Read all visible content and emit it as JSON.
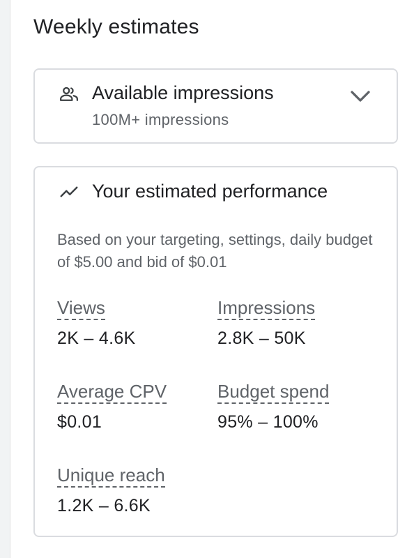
{
  "panel": {
    "title": "Weekly estimates"
  },
  "available_impressions": {
    "icon": "people-icon",
    "title": "Available impressions",
    "subtitle": "100M+ impressions",
    "expand_icon": "chevron-down-icon"
  },
  "performance": {
    "icon": "trending-line-icon",
    "title": "Your estimated performance",
    "description": "Based on your targeting, settings, daily budget of $5.00 and bid of $0.01",
    "metrics": [
      {
        "label": "Views",
        "value": "2K – 4.6K"
      },
      {
        "label": "Impressions",
        "value": "2.8K – 50K"
      },
      {
        "label": "Average CPV",
        "value": "$0.01"
      },
      {
        "label": "Budget spend",
        "value": "95% – 100%"
      },
      {
        "label": "Unique reach",
        "value": "1.2K – 6.6K"
      }
    ]
  },
  "colors": {
    "border": "#dadce0",
    "text_primary": "#202124",
    "text_secondary": "#5f6368"
  }
}
